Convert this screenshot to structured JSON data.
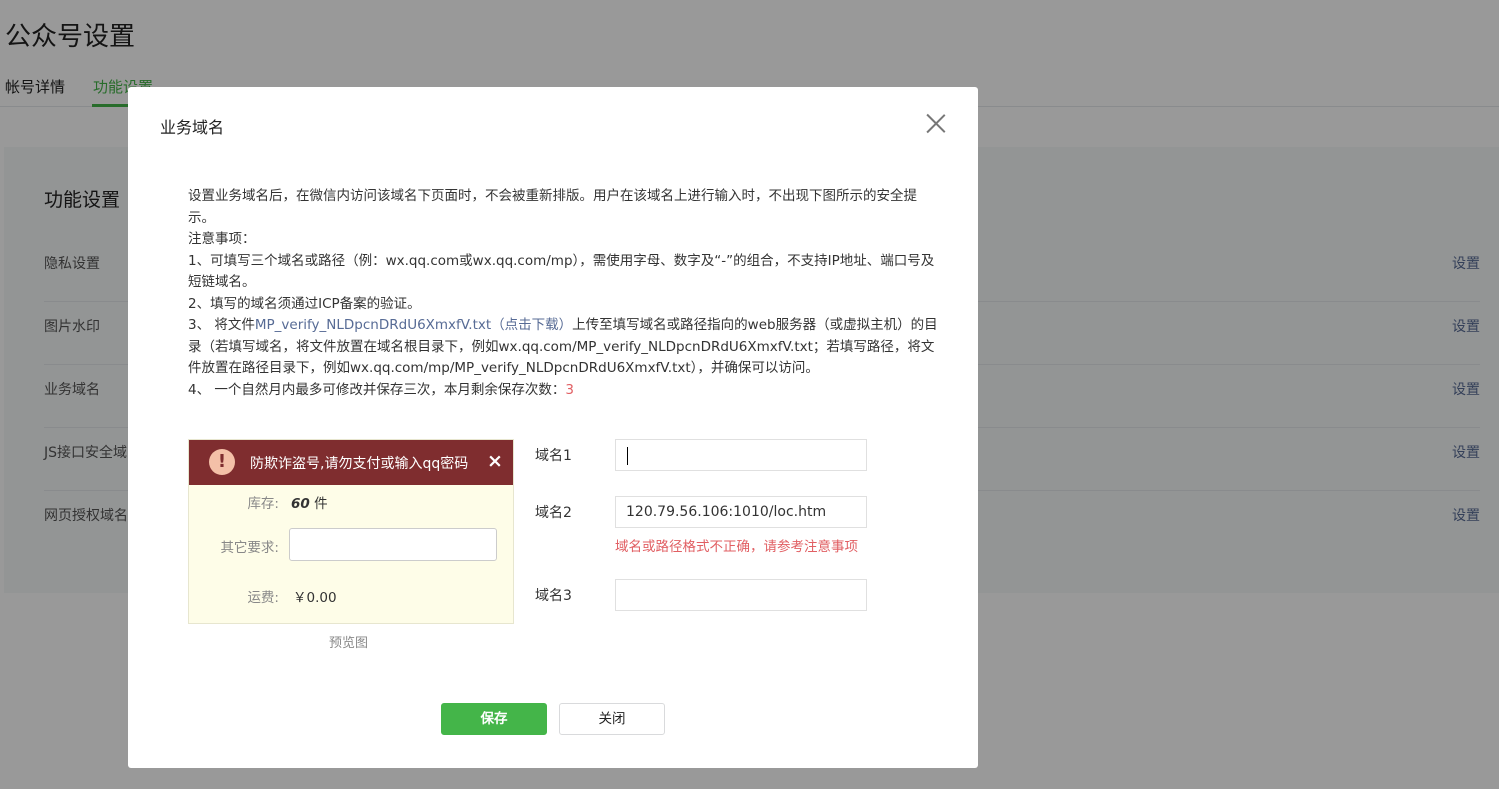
{
  "page": {
    "title": "公众号设置",
    "tabs": [
      "帐号详情",
      "功能设置"
    ],
    "panel_title": "功能设置",
    "rows": [
      {
        "label": "隐私设置",
        "action": "设置"
      },
      {
        "label": "图片水印",
        "action": "设置"
      },
      {
        "label": "业务域名",
        "action": "设置"
      },
      {
        "label": "JS接口安全域",
        "action": "设置"
      },
      {
        "label": "网页授权域名",
        "action": "设置"
      }
    ]
  },
  "dialog": {
    "title": "业务域名",
    "intro": "设置业务域名后，在微信内访问该域名下页面时，不会被重新排版。用户在该域名上进行输入时，不出现下图所示的安全提示。",
    "notes_heading": "注意事项：",
    "note1": "1、可填写三个域名或路径（例：wx.qq.com或wx.qq.com/mp），需使用字母、数字及“-”的组合，不支持IP地址、端口号及短链域名。",
    "note2": "2、填写的域名须通过ICP备案的验证。",
    "note3_prefix": "3、 将文件",
    "note3_link": "MP_verify_NLDpcnDRdU6XmxfV.txt（点击下载）",
    "note3_suffix": "上传至填写域名或路径指向的web服务器（或虚拟主机）的目录（若填写域名，将文件放置在域名根目录下，例如wx.qq.com/MP_verify_NLDpcnDRdU6XmxfV.txt；若填写路径，将文件放置在路径目录下，例如wx.qq.com/mp/MP_verify_NLDpcnDRdU6XmxfV.txt），并确保可以访问。",
    "note4_prefix": "4、 一个自然月内最多可修改并保存三次，本月剩余保存次数：",
    "note4_count": "3",
    "preview": {
      "warning": "防欺诈盗号,请勿支付或输入qq密码",
      "warning_close": "×",
      "stock_label": "库存:",
      "stock_value": "60",
      "stock_unit": " 件",
      "other_label": "其它要求:",
      "other_value": "",
      "shipping_label": "运费:",
      "shipping_value": "￥0.00",
      "caption": "预览图"
    },
    "domains": [
      {
        "label": "域名1",
        "value": ""
      },
      {
        "label": "域名2",
        "value": "120.79.56.106:1010/loc.htm"
      },
      {
        "label": "域名3",
        "value": ""
      }
    ],
    "domain_error": "域名或路径格式不正确，请参考注意事项",
    "save_label": "保存",
    "close_label": "关闭"
  },
  "colors": {
    "accent": "#44b549",
    "link": "#576b95",
    "error": "#e15f63",
    "warning_bar": "#7f2d2f"
  }
}
